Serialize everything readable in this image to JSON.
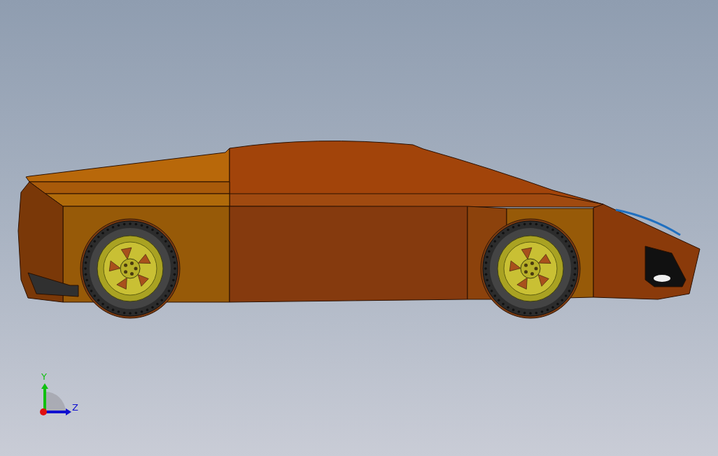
{
  "viewport": {
    "triad": {
      "axes": [
        {
          "label": "Y",
          "kind": "vertical",
          "color": "#10c010"
        },
        {
          "label": "Z",
          "kind": "horizontal",
          "color": "#1010d0"
        }
      ]
    }
  }
}
